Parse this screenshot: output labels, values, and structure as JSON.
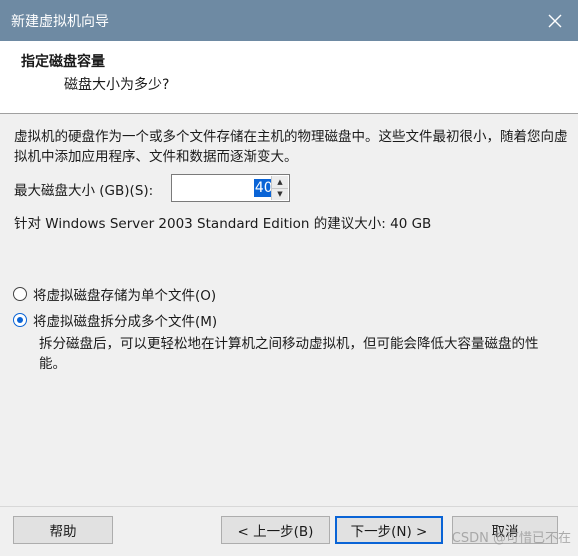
{
  "window": {
    "title": "新建虚拟机向导",
    "close_icon": "close-icon"
  },
  "header": {
    "title": "指定磁盘容量",
    "subtitle": "磁盘大小为多少?"
  },
  "body": {
    "description": "虚拟机的硬盘作为一个或多个文件存储在主机的物理磁盘中。这些文件最初很小，随着您向虚拟机中添加应用程序、文件和数据而逐渐变大。",
    "size_label": "最大磁盘大小 (GB)(S):",
    "size_value": "40.0",
    "recommend": "针对 Windows Server 2003 Standard Edition 的建议大小: 40 GB",
    "options": [
      {
        "label": "将虚拟磁盘存储为单个文件(O)",
        "checked": false
      },
      {
        "label": "将虚拟磁盘拆分成多个文件(M)",
        "checked": true
      }
    ],
    "split_note": "拆分磁盘后，可以更轻松地在计算机之间移动虚拟机，但可能会降低大容量磁盘的性能。"
  },
  "footer": {
    "help": "帮助",
    "back": "< 上一步(B)",
    "next": "下一步(N) >",
    "cancel": "取消"
  },
  "watermark": "CSDN @可惜已不在",
  "colors": {
    "accent": "#0a64d6",
    "titlebar": "#6e8aa3"
  }
}
